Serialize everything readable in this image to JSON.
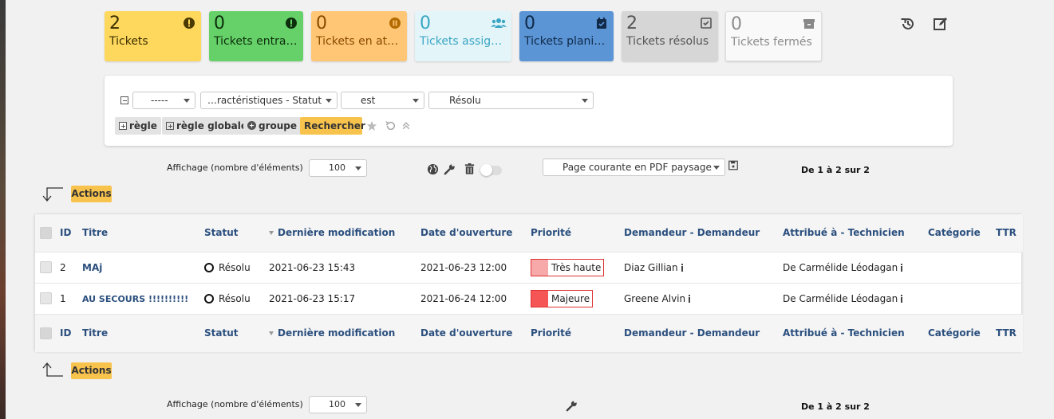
{
  "tiles": [
    {
      "count": "2",
      "label": "Tickets",
      "bg": "#fed85d",
      "color": "#3a2e00",
      "icon": "exclamation-circle-icon"
    },
    {
      "count": "0",
      "label": "Tickets entrants",
      "bg": "#66d168",
      "color": "#0d2e0d",
      "icon": "exclamation-circle-icon"
    },
    {
      "count": "0",
      "label": "Tickets en attente",
      "bg": "#ffc676",
      "color": "#8a4b00",
      "icon": "pause-circle-icon"
    },
    {
      "count": "0",
      "label": "Tickets assignés",
      "bg": "#e4f5f9",
      "color": "#3aa6c4",
      "icon": "users-icon"
    },
    {
      "count": "0",
      "label": "Tickets planifiés",
      "bg": "#5b95d6",
      "color": "#102a48",
      "icon": "calendar-check-icon"
    },
    {
      "count": "2",
      "label": "Tickets résolus",
      "bg": "#d6d6d6",
      "color": "#555555",
      "icon": "check-square-icon"
    },
    {
      "count": "0",
      "label": "Tickets fermés",
      "bg": "#f9f9f9",
      "color": "#8c8c8c",
      "icon": "archive-icon"
    }
  ],
  "top_icons": {
    "history": "history-icon",
    "edit": "edit-icon"
  },
  "filter": {
    "select1": "-----",
    "select2": "…ractéristiques - Statut",
    "select3": "est",
    "select4": "Résolu",
    "btn_rule": "règle",
    "btn_global_rule": "règle globale",
    "btn_group": "groupe",
    "btn_search": "Rechercher"
  },
  "list_controls": {
    "display_label": "Affichage (nombre d'éléments)",
    "display_value": "100",
    "export_value": "Page courante en PDF paysage",
    "pagination": "De 1 à 2 sur 2"
  },
  "actions_label": "Actions",
  "table": {
    "headers": [
      "ID",
      "Titre",
      "Statut",
      "Dernière modification",
      "Date d'ouverture",
      "Priorité",
      "Demandeur - Demandeur",
      "Attribué à - Technicien",
      "Catégorie",
      "TTR"
    ],
    "rows": [
      {
        "id": "2",
        "title": "MAj",
        "status": "Résolu",
        "modified": "2021-06-23 15:43",
        "opened": "2021-06-23 12:00",
        "priority": "Très haute",
        "priority_color": "#f7a8a8",
        "requester": "Diaz Gillian",
        "assigned": "De Carmélide Léodagan",
        "category": "",
        "ttr": ""
      },
      {
        "id": "1",
        "title": "AU SECOURS !!!!!!!!!!",
        "status": "Résolu",
        "modified": "2021-06-23 15:17",
        "opened": "2021-06-24 12:00",
        "priority": "Majeure",
        "priority_color": "#f55555",
        "requester": "Greene Alvin",
        "assigned": "De Carmélide Léodagan",
        "category": "",
        "ttr": ""
      }
    ]
  }
}
